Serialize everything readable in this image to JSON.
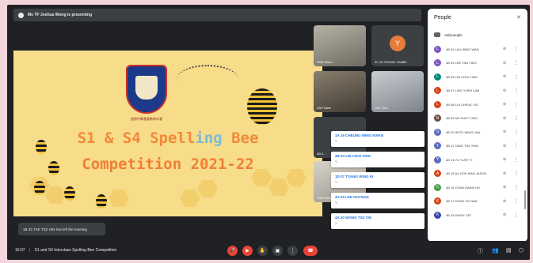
{
  "presenting": {
    "text": "Ms TF Joshua Wong is presenting"
  },
  "slide": {
    "crest_label": "香港中華基督教青年會",
    "line1_a": "S1 & S4 Spell",
    "line1_b": "ing",
    "line1_c": " Bee",
    "line2": "Competition 2021-22"
  },
  "toast": {
    "text": "1B 33 TSE TSZ HIN has left the meeting"
  },
  "tiles": [
    {
      "name": "HWF Alvin..."
    },
    {
      "name": "4C 20 YEUNG YZABE..."
    },
    {
      "name": "LWF Allan"
    },
    {
      "name": "LWL Tina"
    },
    {
      "name": "4B 0..."
    },
    {
      "name": "CSS Kerry"
    }
  ],
  "chat_popups": [
    {
      "name": "1A 19 CHEUNG WING KWAN",
      "msg": "Y"
    },
    {
      "name": "4B 04 LIN CHOI YING",
      "msg": "Y"
    },
    {
      "name": "1D 07 TSANG WING KI",
      "msg": "Y"
    },
    {
      "name": "4A 03 LEE HOI MAN",
      "msg": "Y"
    },
    {
      "name": "4A 20 WONG TSZ YIN",
      "msg": "Y"
    }
  ],
  "people_panel": {
    "title": "People",
    "add_label": "Add people",
    "rows": [
      {
        "initial": "L",
        "name": "4B 04 LAU WING WAN",
        "color": "#7e57c2"
      },
      {
        "initial": "L",
        "name": "4B 05 LEE YAN TING",
        "color": "#7e57c2"
      },
      {
        "initial": "L",
        "name": "4B 06 LIN CHOI YING",
        "color": "#00897b"
      },
      {
        "initial": "L",
        "name": "4B 07 LING YUEN LAM",
        "color": "#d84315"
      },
      {
        "initial": "L",
        "name": "4B 08 LUI CHEUK YIU",
        "color": "#d84315"
      },
      {
        "initial": "N",
        "name": "4B 09 NG SUET YING",
        "color": "#6d4c41"
      },
      {
        "initial": "S",
        "name": "4B 10 SETO WING YAN",
        "color": "#5c6bc0"
      },
      {
        "initial": "T",
        "name": "4B 11 TANG TSZ YING",
        "color": "#5c6bc0"
      },
      {
        "initial": "Y",
        "name": "4B 14 YU YUET YI",
        "color": "#5c6bc0"
      },
      {
        "initial": "A",
        "name": "4B 15 AU HOK MAN JASON",
        "color": "#d84315"
      },
      {
        "initial": "C",
        "name": "4B 16 CHAN KWAN HO",
        "color": "#43a047"
      },
      {
        "initial": "K",
        "name": "4B 17 KONG CE NAN",
        "color": "#d84315"
      },
      {
        "initial": "K",
        "name": "4B 18 KWOK YAT",
        "color": "#3949ab"
      }
    ]
  },
  "bottom": {
    "time": "15:07",
    "meeting": "S1 and S4 Interclass Spelling Bee Competition"
  }
}
